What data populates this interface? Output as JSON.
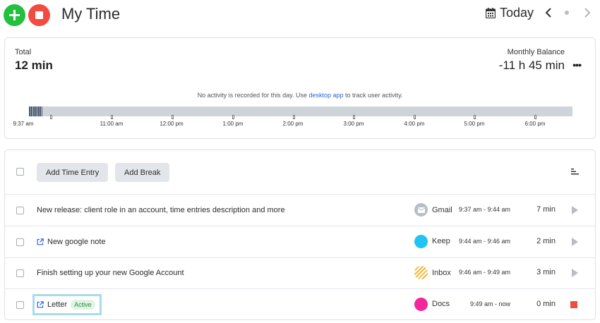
{
  "header": {
    "title": "My Time",
    "date_label": "Today",
    "add_icon": "plus-icon",
    "stop_icon": "stop-icon",
    "calendar_icon": "calendar-icon"
  },
  "summary": {
    "total_label": "Total",
    "total_value": "12 min",
    "balance_label": "Monthly Balance",
    "balance_value": "-11 h 45 min",
    "notice_before": "No activity is recorded for this day. Use",
    "notice_link": "desktop app",
    "notice_after": "to track user activity.",
    "timeline_labels": [
      "9:37 am",
      "11:00 am",
      "12:00 pm",
      "1:00 pm",
      "2:00 pm",
      "3:00 pm",
      "4:00 pm",
      "5:00 pm",
      "6:00 pm"
    ]
  },
  "toolbar": {
    "add_entry_label": "Add Time Entry",
    "add_break_label": "Add Break"
  },
  "entries": [
    {
      "title": "New release: client role in an account, time entries description and more",
      "app": "Gmail",
      "app_color": "#b9bec6",
      "range": "9:37 am - 9:44 am",
      "duration": "7 min",
      "has_link": false,
      "badge": "",
      "action": "play"
    },
    {
      "title": "New google note",
      "app": "Keep",
      "app_color": "#1ec4f2",
      "range": "9:44 am - 9:46 am",
      "duration": "2 min",
      "has_link": true,
      "badge": "",
      "action": "play"
    },
    {
      "title": "Finish setting up your new Google Account",
      "app": "Inbox",
      "app_color": "#f2b63a",
      "range": "9:46 am - 9:49 am",
      "duration": "3 min",
      "has_link": false,
      "badge": "",
      "action": "play"
    },
    {
      "title": "Letter",
      "app": "Docs",
      "app_color": "#f0289b",
      "range": "9:49 am - now",
      "duration": "0 min",
      "has_link": true,
      "badge": "Active",
      "action": "stop"
    }
  ],
  "colors": {
    "accent_green": "#22c03c",
    "accent_red": "#f24b3f",
    "link": "#2b65d9"
  }
}
